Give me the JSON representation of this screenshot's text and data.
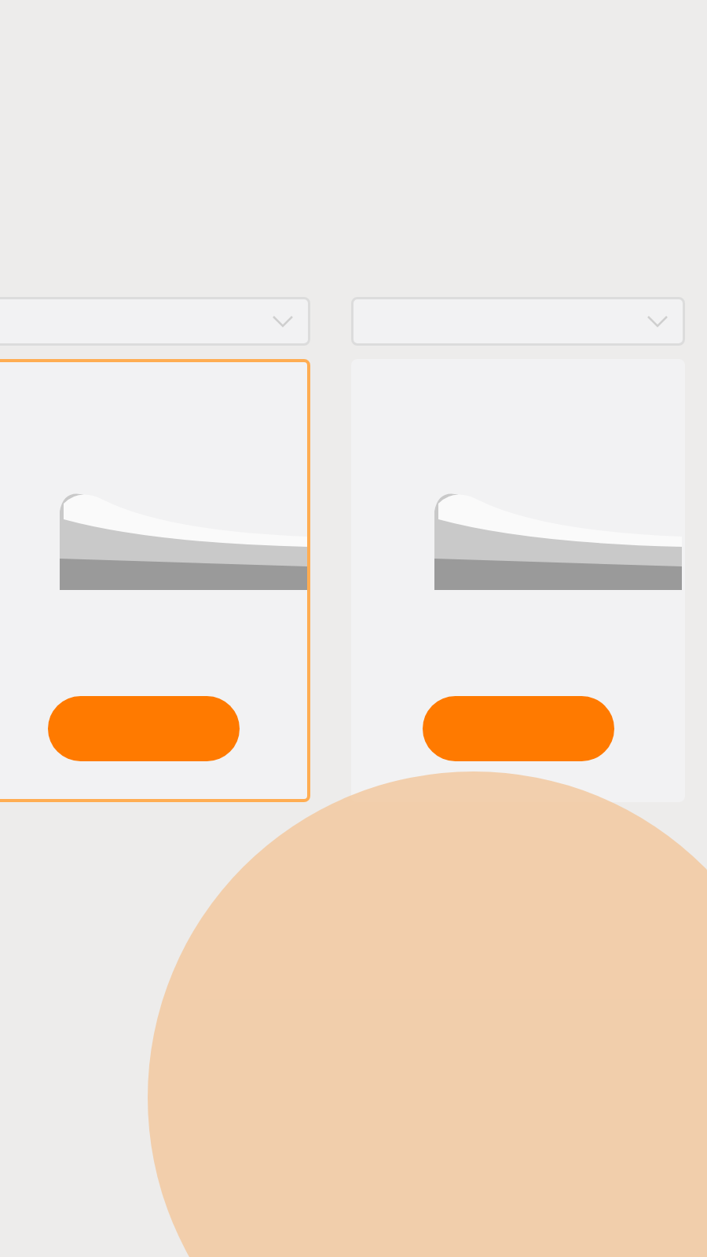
{
  "products": [
    {
      "selected": true
    },
    {
      "selected": false
    }
  ]
}
